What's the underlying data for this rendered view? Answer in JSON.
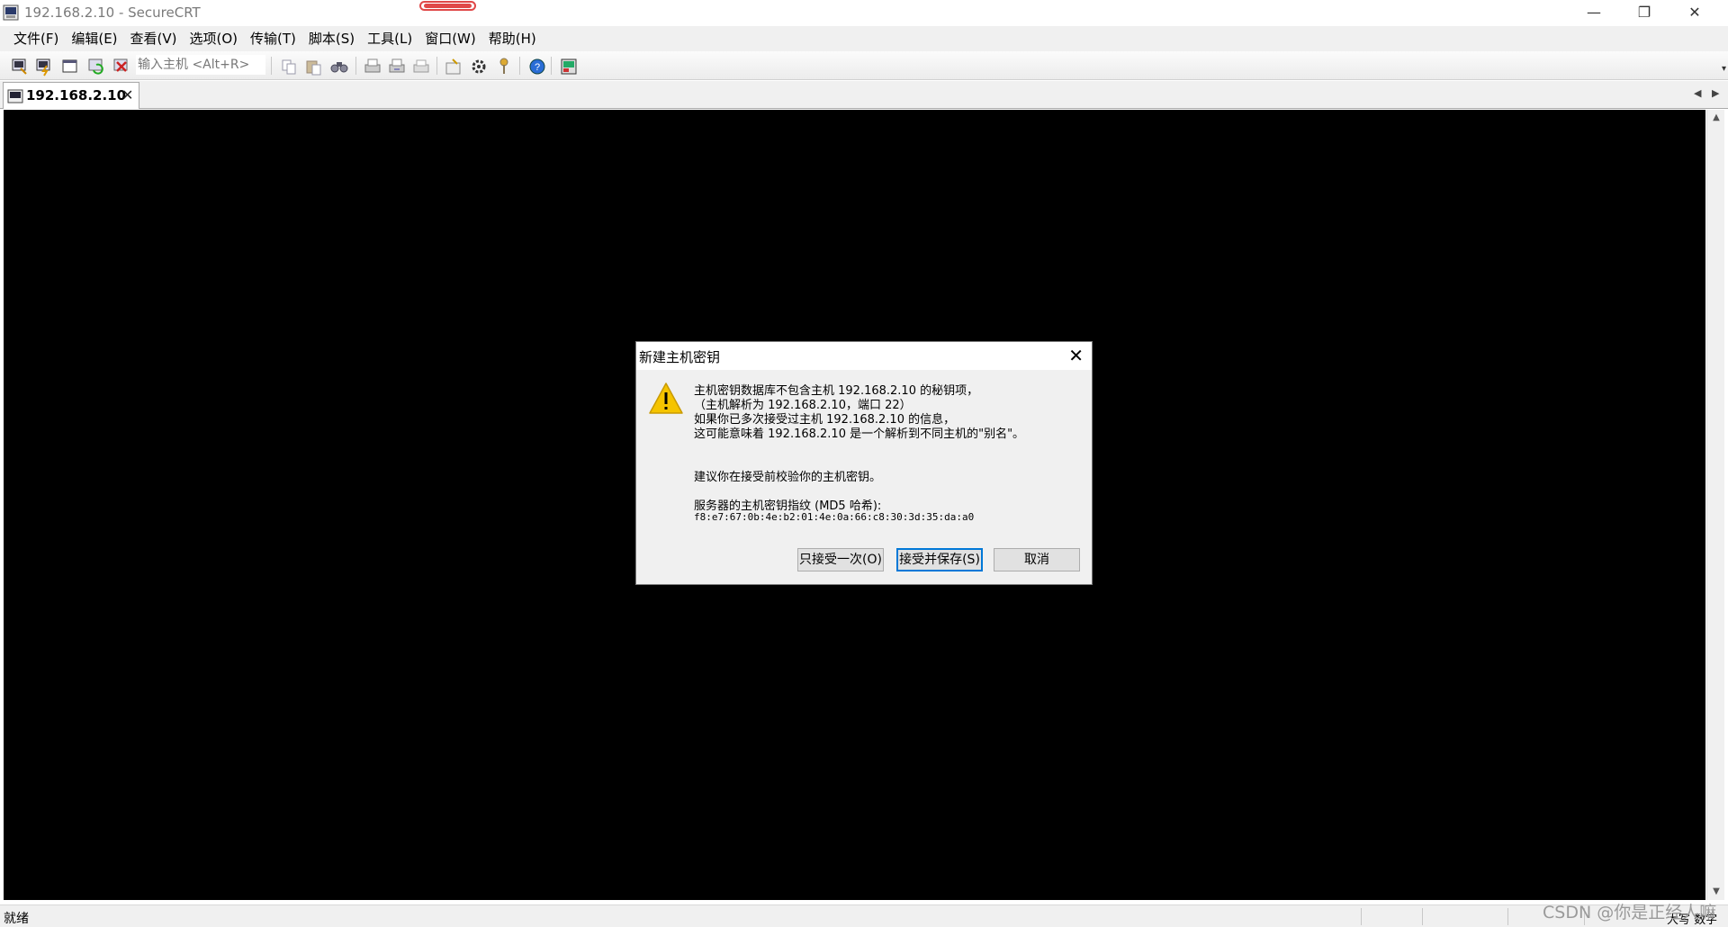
{
  "window": {
    "title": "192.168.2.10 - SecureCRT",
    "minimize_glyph": "—",
    "restore_glyph": "❐",
    "close_glyph": "✕"
  },
  "menu": [
    {
      "label": "文件(F)"
    },
    {
      "label": "编辑(E)"
    },
    {
      "label": "查看(V)"
    },
    {
      "label": "选项(O)"
    },
    {
      "label": "传输(T)"
    },
    {
      "label": "脚本(S)"
    },
    {
      "label": "工具(L)"
    },
    {
      "label": "窗口(W)"
    },
    {
      "label": "帮助(H)"
    }
  ],
  "toolbar": {
    "host_input_placeholder": "输入主机 <Alt+R>",
    "icons": [
      "connect-icon",
      "quick-connect-icon",
      "connect-tab-icon",
      "reconnect-icon",
      "disconnect-icon",
      "copy-icon",
      "paste-icon",
      "find-icon",
      "print-icon",
      "print-selection-icon",
      "print-setup-icon",
      "session-options-icon",
      "global-options-icon",
      "keymap-icon",
      "help-icon",
      "activator-icon"
    ]
  },
  "tabs": [
    {
      "label": "192.168.2.10",
      "close_glyph": "✕"
    }
  ],
  "dialog": {
    "title": "新建主机密钥",
    "close_glyph": "✕",
    "message_lines": [
      "主机密钥数据库不包含主机 192.168.2.10 的秘钥项，",
      "（主机解析为 192.168.2.10，端口 22）",
      "如果你已多次接受过主机 192.168.2.10 的信息，",
      "这可能意味着 192.168.2.10 是一个解析到不同主机的\"别名\"。"
    ],
    "suggestion": "建议你在接受前校验你的主机密钥。",
    "fingerprint_label": "服务器的主机密钥指纹 (MD5 哈希):",
    "fingerprint": "f8:e7:67:0b:4e:b2:01:4e:0a:66:c8:30:3d:35:da:a0",
    "buttons": {
      "accept_once": "只接受一次(O)",
      "accept_save": "接受并保存(S)",
      "cancel": "取消"
    }
  },
  "status": {
    "text": "就绪",
    "caps": "大写 数字",
    "watermark": "CSDN @你是正经人嘛"
  },
  "colors": {
    "terminal_bg": "#000000",
    "accent": "#0078d7",
    "warning": "#f5c400"
  }
}
